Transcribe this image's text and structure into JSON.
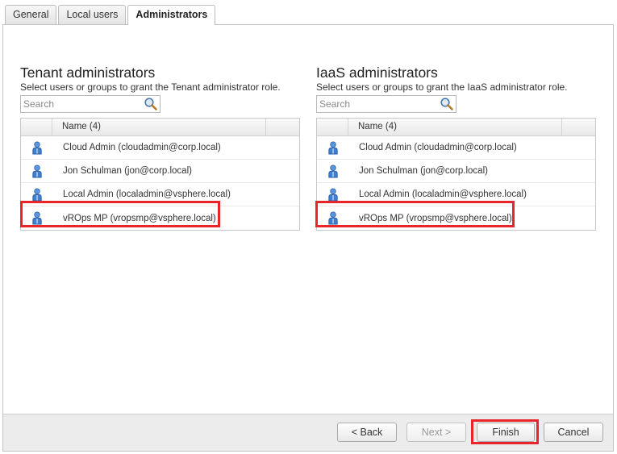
{
  "tabs": [
    {
      "label": "General",
      "active": false
    },
    {
      "label": "Local users",
      "active": false
    },
    {
      "label": "Administrators",
      "active": true
    }
  ],
  "tenant": {
    "title": "Tenant administrators",
    "description": "Select users or groups to grant the Tenant administrator role.",
    "search_placeholder": "Search",
    "column_name": "Name (4)",
    "users": [
      "Cloud Admin (cloudadmin@corp.local)",
      "Jon Schulman (jon@corp.local)",
      "Local Admin (localadmin@vsphere.local)",
      "vROps MP (vropsmp@vsphere.local)"
    ]
  },
  "iaas": {
    "title": "IaaS administrators",
    "description": "Select users or groups to grant the IaaS administrator role.",
    "search_placeholder": "Search",
    "column_name": "Name (4)",
    "users": [
      "Cloud Admin (cloudadmin@corp.local)",
      "Jon Schulman (jon@corp.local)",
      "Local Admin (localadmin@vsphere.local)",
      "vROps MP (vropsmp@vsphere.local)"
    ]
  },
  "footer": {
    "back_label": "< Back",
    "next_label": "Next >",
    "finish_label": "Finish",
    "cancel_label": "Cancel"
  },
  "colors": {
    "highlight": "#e8262a",
    "user_icon": "#3f7fd0"
  },
  "icons": {
    "search": "magnifier-icon",
    "user": "user-icon"
  }
}
